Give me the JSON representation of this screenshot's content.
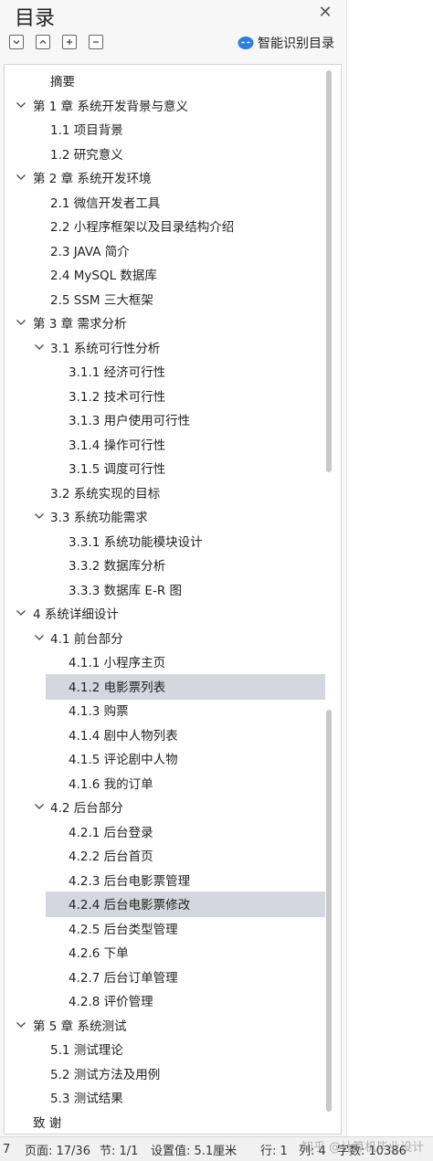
{
  "panel": {
    "title": "目录",
    "close_glyph": "✕",
    "toolbar": {
      "buttons": [
        {
          "icon": "collapse-down-icon"
        },
        {
          "icon": "expand-up-icon"
        },
        {
          "icon": "plus-icon"
        },
        {
          "icon": "minus-icon"
        }
      ]
    },
    "smart_button": {
      "label": "智能识别目录",
      "icon": "smart-recognize-icon",
      "color": "#2f7de1"
    }
  },
  "toc": [
    {
      "label": "摘要",
      "level": 1,
      "chevron": false
    },
    {
      "label": "第 1 章  系统开发背景与意义",
      "level": 0,
      "chevron": true
    },
    {
      "label": "1.1 项目背景",
      "level": 1,
      "chevron": false
    },
    {
      "label": "1.2 研究意义",
      "level": 1,
      "chevron": false
    },
    {
      "label": "第 2 章  系统开发环境",
      "level": 0,
      "chevron": true
    },
    {
      "label": "2.1 微信开发者工具",
      "level": 1,
      "chevron": false
    },
    {
      "label": "2.2 小程序框架以及目录结构介绍",
      "level": 1,
      "chevron": false
    },
    {
      "label": "2.3 JAVA 简介",
      "level": 1,
      "chevron": false
    },
    {
      "label": "2.4 MySQL 数据库",
      "level": 1,
      "chevron": false
    },
    {
      "label": "2.5 SSM 三大框架",
      "level": 1,
      "chevron": false
    },
    {
      "label": "第 3 章  需求分析",
      "level": 0,
      "chevron": true
    },
    {
      "label": "3.1 系统可行性分析",
      "level": 1,
      "chevron": true
    },
    {
      "label": "3.1.1 经济可行性",
      "level": 2,
      "chevron": false
    },
    {
      "label": "3.1.2 技术可行性",
      "level": 2,
      "chevron": false
    },
    {
      "label": "3.1.3 用户使用可行性",
      "level": 2,
      "chevron": false
    },
    {
      "label": "3.1.4 操作可行性",
      "level": 2,
      "chevron": false
    },
    {
      "label": "3.1.5 调度可行性",
      "level": 2,
      "chevron": false
    },
    {
      "label": "3.2  系统实现的目标",
      "level": 1,
      "chevron": false
    },
    {
      "label": "3.3  系统功能需求",
      "level": 1,
      "chevron": true
    },
    {
      "label": "3.3.1  系统功能模块设计",
      "level": 2,
      "chevron": false
    },
    {
      "label": "3.3.2  数据库分析",
      "level": 2,
      "chevron": false
    },
    {
      "label": "3.3.3  数据库 E-R 图",
      "level": 2,
      "chevron": false
    },
    {
      "label": "4  系统详细设计",
      "level": 0,
      "chevron": true
    },
    {
      "label": "4.1  前台部分",
      "level": 1,
      "chevron": true
    },
    {
      "label": "4.1.1 小程序主页",
      "level": 2,
      "chevron": false
    },
    {
      "label": "4.1.2 电影票列表",
      "level": 2,
      "chevron": false,
      "selected": true
    },
    {
      "label": "4.1.3 购票",
      "level": 2,
      "chevron": false
    },
    {
      "label": "4.1.4  剧中人物列表",
      "level": 2,
      "chevron": false
    },
    {
      "label": "4.1.5  评论剧中人物",
      "level": 2,
      "chevron": false
    },
    {
      "label": "4.1.6 我的订单",
      "level": 2,
      "chevron": false
    },
    {
      "label": "4.2  后台部分",
      "level": 1,
      "chevron": true
    },
    {
      "label": "4.2.1 后台登录",
      "level": 2,
      "chevron": false
    },
    {
      "label": "4.2.2  后台首页",
      "level": 2,
      "chevron": false
    },
    {
      "label": "4.2.3  后台电影票管理",
      "level": 2,
      "chevron": false
    },
    {
      "label": "4.2.4  后台电影票修改",
      "level": 2,
      "chevron": false,
      "selected": true
    },
    {
      "label": "4.2.5  后台类型管理",
      "level": 2,
      "chevron": false
    },
    {
      "label": "4.2.6  下单",
      "level": 2,
      "chevron": false
    },
    {
      "label": "4.2.7  后台订单管理",
      "level": 2,
      "chevron": false
    },
    {
      "label": "4.2.8  评价管理",
      "level": 2,
      "chevron": false
    },
    {
      "label": "第 5 章   系统测试",
      "level": 0,
      "chevron": true
    },
    {
      "label": "5.1  测试理论",
      "level": 1,
      "chevron": false
    },
    {
      "label": "5.2  测试方法及用例",
      "level": 1,
      "chevron": false
    },
    {
      "label": "5.3 测试结果",
      "level": 1,
      "chevron": false
    },
    {
      "label": "致      谢",
      "level": 0,
      "chevron": false
    }
  ],
  "statusbar": {
    "left_fragment": "7",
    "page": "页面: 17/36",
    "section": "节: 1/1",
    "setting": "设置值: 5.1厘米",
    "row": "行: 1",
    "col": "列: 4",
    "words": "字数: 10386"
  },
  "watermark": "知乎 @计算机毕业设计"
}
